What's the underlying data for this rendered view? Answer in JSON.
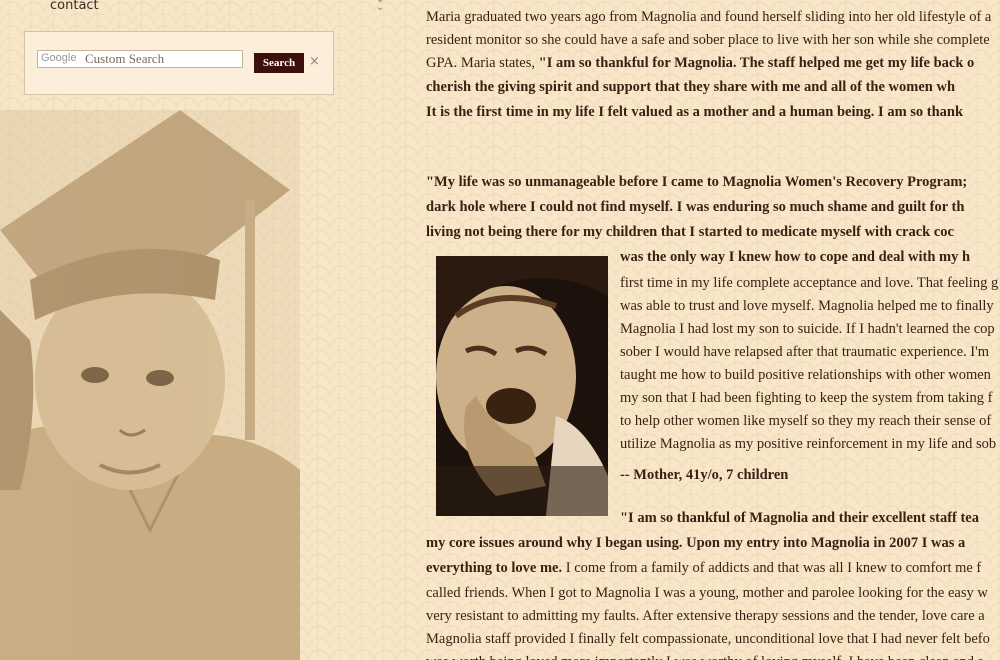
{
  "nav": {
    "contact": "contact"
  },
  "search": {
    "brand": "Google",
    "placeholder": "Custom Search",
    "button_label": "Search",
    "clear_symbol": "×"
  },
  "article": {
    "para1": [
      {
        "text": "Maria graduated two years ago from Magnolia and found herself sliding into her old lifestyle of a",
        "bold": false
      },
      {
        "text": "resident monitor so she could have a safe and sober place to live with her son while she complete",
        "bold": false
      },
      {
        "text_plain": "GPA. Maria states, ",
        "text_bold": "\"I am so thankful for Magnolia. The staff helped me get my life back o"
      },
      {
        "text": "cherish the giving spirit and support that they share with me and all of the women wh",
        "bold": true
      },
      {
        "text": "It is the first time in my life I felt valued as a mother and a human being. I am so thank",
        "bold": true
      }
    ],
    "para2": [
      {
        "text": "\"My life was so unmanageable before I came to Magnolia Women's Recovery Program; ",
        "bold": true
      },
      {
        "text": "dark hole where I could not find myself. I was enduring so much shame and guilt for th",
        "bold": true
      },
      {
        "text": "living not being there for my children that I started to medicate myself with crack coc",
        "bold": true
      },
      {
        "text": "was the only way I knew how to cope and deal with my h",
        "bold": true
      },
      {
        "text": "first time in my life complete acceptance and love. That feeling g",
        "bold": false
      },
      {
        "text": "was able to trust and love myself. Magnolia helped me to finally",
        "bold": false
      },
      {
        "text": "Magnolia I had lost my son to suicide. If I hadn't learned the cop",
        "bold": false
      },
      {
        "text": "sober I would have relapsed after that traumatic experience. I'm",
        "bold": false
      },
      {
        "text": "taught me how to build positive relationships with other women",
        "bold": false
      },
      {
        "text": "my son that I had been fighting to keep the system from taking f",
        "bold": false
      },
      {
        "text": "to help other women like myself so they my reach their sense of",
        "bold": false
      },
      {
        "text": "utilize Magnolia as my positive reinforcement in my life and sob",
        "bold": false
      }
    ],
    "attribution": "-- Mother, 41y/o, 7 children",
    "para3": [
      {
        "text": "\"I am so thankful of Magnolia and their excellent staff tea",
        "bold": true
      },
      {
        "text": "my core issues around why I began using. Upon my entry into Magnolia in 2007 I was a",
        "bold": true
      },
      {
        "text_bold": "everything to love me.",
        "text_plain": " I come from a family of addicts and that was all I knew to comfort me f"
      },
      {
        "text": "called friends. When I got to Magnolia I was a young, mother and parolee looking for the easy w",
        "bold": false
      },
      {
        "text": "very resistant to admitting my faults. After extensive therapy sessions and the tender, love care a",
        "bold": false
      },
      {
        "text": "Magnolia staff provided I finally felt compassionate, unconditional love that I had never felt befo",
        "bold": false
      },
      {
        "text": "was worth being loved more importantly I was worthy of loving myself. I have been clean and s",
        "bold": false
      }
    ]
  }
}
